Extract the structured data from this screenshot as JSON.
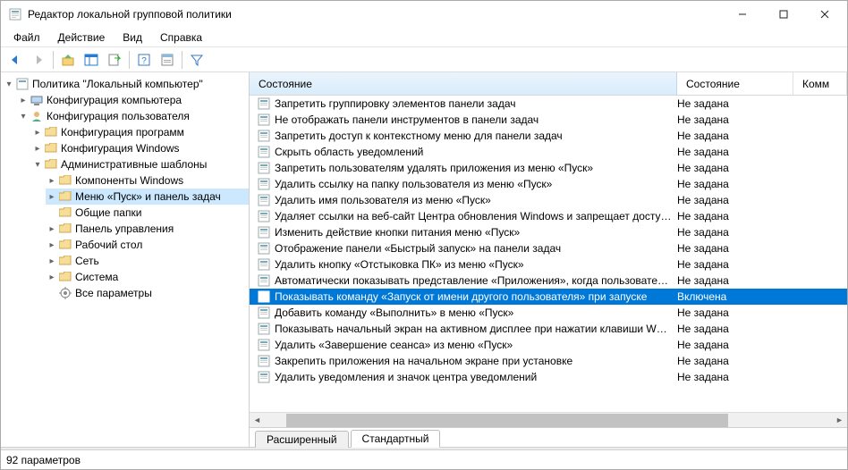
{
  "window": {
    "title": "Редактор локальной групповой политики"
  },
  "menu": {
    "file": "Файл",
    "action": "Действие",
    "view": "Вид",
    "help": "Справка"
  },
  "tree": {
    "root": "Политика \"Локальный компьютер\"",
    "cc": "Конфигурация компьютера",
    "uc": "Конфигурация пользователя",
    "uc_children": {
      "soft": "Конфигурация программ",
      "win": "Конфигурация Windows",
      "adm": "Административные шаблоны",
      "adm_children": {
        "compw": "Компоненты Windows",
        "start": "Меню «Пуск» и панель задач",
        "shared": "Общие папки",
        "cpanel": "Панель управления",
        "desktop": "Рабочий стол",
        "network": "Сеть",
        "system": "Система",
        "all": "Все параметры"
      }
    }
  },
  "columns": {
    "c1": "Состояние",
    "c2": "Состояние",
    "c3": "Комм"
  },
  "list": [
    {
      "name": "Запретить группировку элементов панели задач",
      "state": "Не задана",
      "selected": false
    },
    {
      "name": "Не отображать панели инструментов в панели задач",
      "state": "Не задана",
      "selected": false
    },
    {
      "name": "Запретить доступ к контекстному меню для панели задач",
      "state": "Не задана",
      "selected": false
    },
    {
      "name": "Скрыть область уведомлений",
      "state": "Не задана",
      "selected": false
    },
    {
      "name": "Запретить пользователям удалять приложения из меню «Пуск»",
      "state": "Не задана",
      "selected": false
    },
    {
      "name": "Удалить ссылку на папку пользователя из меню «Пуск»",
      "state": "Не задана",
      "selected": false
    },
    {
      "name": "Удалить имя пользователя из меню «Пуск»",
      "state": "Не задана",
      "selected": false
    },
    {
      "name": "Удаляет ссылки на веб-сайт Центра обновления Windows и запрещает досту…",
      "state": "Не задана",
      "selected": false
    },
    {
      "name": "Изменить действие кнопки питания меню «Пуск»",
      "state": "Не задана",
      "selected": false
    },
    {
      "name": "Отображение панели «Быстрый запуск» на панели задач",
      "state": "Не задана",
      "selected": false
    },
    {
      "name": "Удалить кнопку «Отстыковка ПК» из меню «Пуск»",
      "state": "Не задана",
      "selected": false
    },
    {
      "name": "Автоматически показывать представление «Приложения», когда пользовате…",
      "state": "Не задана",
      "selected": false
    },
    {
      "name": "Показывать команду «Запуск от имени другого пользователя» при запуске",
      "state": "Включена",
      "selected": true
    },
    {
      "name": "Добавить команду «Выполнить» в меню «Пуск»",
      "state": "Не задана",
      "selected": false
    },
    {
      "name": "Показывать начальный экран на активном дисплее при нажатии клавиши W…",
      "state": "Не задана",
      "selected": false
    },
    {
      "name": "Удалить «Завершение сеанса» из меню «Пуск»",
      "state": "Не задана",
      "selected": false
    },
    {
      "name": "Закрепить приложения на начальном экране при установке",
      "state": "Не задана",
      "selected": false
    },
    {
      "name": "Удалить уведомления и значок центра уведомлений",
      "state": "Не задана",
      "selected": false
    }
  ],
  "tabs": {
    "extended": "Расширенный",
    "standard": "Стандартный"
  },
  "status": "92 параметров"
}
